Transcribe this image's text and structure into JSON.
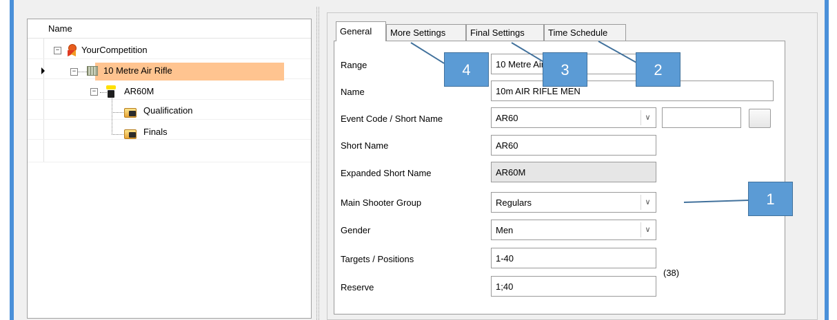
{
  "tree": {
    "header": "Name",
    "nodes": [
      {
        "label": "YourCompetition",
        "icon": "ribbon-icon",
        "expander": "−"
      },
      {
        "label": "10 Metre Air Rifle",
        "icon": "range-icon",
        "expander": "−"
      },
      {
        "label": "AR60M",
        "icon": "rifle-icon",
        "expander": "−",
        "selected": true
      },
      {
        "label": "Qualification",
        "icon": "folder-icon"
      },
      {
        "label": "Finals",
        "icon": "folder-icon"
      }
    ]
  },
  "tabs": [
    {
      "label": "General",
      "active": true
    },
    {
      "label": "More Settings"
    },
    {
      "label": "Final Settings"
    },
    {
      "label": "Time Schedule"
    }
  ],
  "form": {
    "range": {
      "label": "Range",
      "value": "10 Metre Air Rifle"
    },
    "name": {
      "label": "Name",
      "value": "10m AIR RIFLE MEN"
    },
    "event_code": {
      "label": "Event Code / Short Name",
      "value": "AR60",
      "extra_value": ""
    },
    "short_name": {
      "label": "Short Name",
      "value": "AR60"
    },
    "expanded_short_name": {
      "label": "Expanded Short Name",
      "value": "AR60M"
    },
    "main_shooter_group": {
      "label": "Main Shooter Group",
      "value": "Regulars"
    },
    "gender": {
      "label": "Gender",
      "value": "Men"
    },
    "targets": {
      "label": "Targets / Positions",
      "value": "1-40"
    },
    "reserve": {
      "label": "Reserve",
      "value": "1;40"
    },
    "count_note": "(38)"
  },
  "callouts": [
    "1",
    "2",
    "3",
    "4"
  ],
  "colors": {
    "accent": "#5b9bd5",
    "selected_row": "#ffc490",
    "window_edge": "#4a90d9"
  }
}
